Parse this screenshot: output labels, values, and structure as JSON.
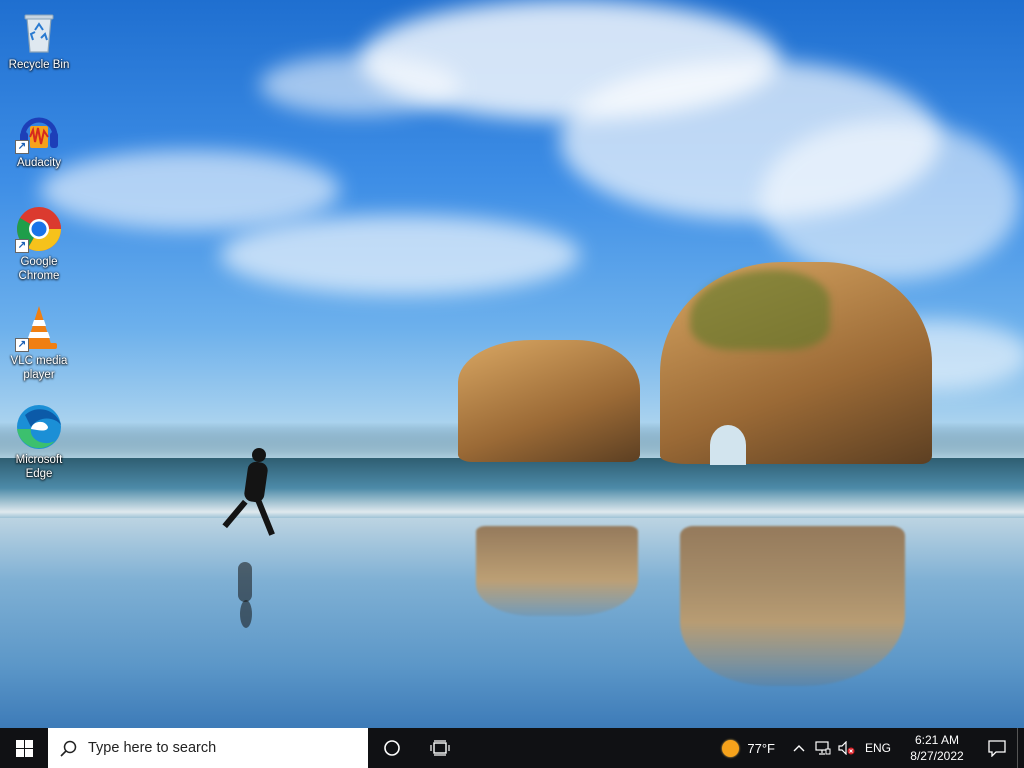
{
  "desktop": {
    "icons": [
      {
        "label": "Recycle Bin",
        "icon": "recycle-bin-icon",
        "shortcut": false
      },
      {
        "label": "Audacity",
        "icon": "audacity-icon",
        "shortcut": true
      },
      {
        "label": "Google Chrome",
        "icon": "chrome-icon",
        "shortcut": true
      },
      {
        "label": "VLC media player",
        "icon": "vlc-icon",
        "shortcut": true
      },
      {
        "label": "Microsoft Edge",
        "icon": "edge-icon",
        "shortcut": true
      }
    ],
    "wallpaper": "beach-rocks-runner-wallpaper"
  },
  "taskbar": {
    "start_icon": "windows-logo-icon",
    "search": {
      "placeholder": "Type here to search",
      "value": ""
    },
    "cortana_icon": "cortana-circle-icon",
    "task_view_icon": "task-view-icon",
    "weather": {
      "temperature": "77°F",
      "icon": "sun-icon"
    },
    "tray": {
      "chevron_icon": "chevron-up-icon",
      "network_icon": "network-icon",
      "volume_icon": "volume-muted-icon",
      "language": "ENG"
    },
    "clock": {
      "time": "6:21 AM",
      "date": "8/27/2022"
    },
    "notifications_icon": "notification-icon"
  },
  "colors": {
    "taskbar": "#101114",
    "sun": "#f6a21b",
    "search_bg": "#ffffff"
  }
}
